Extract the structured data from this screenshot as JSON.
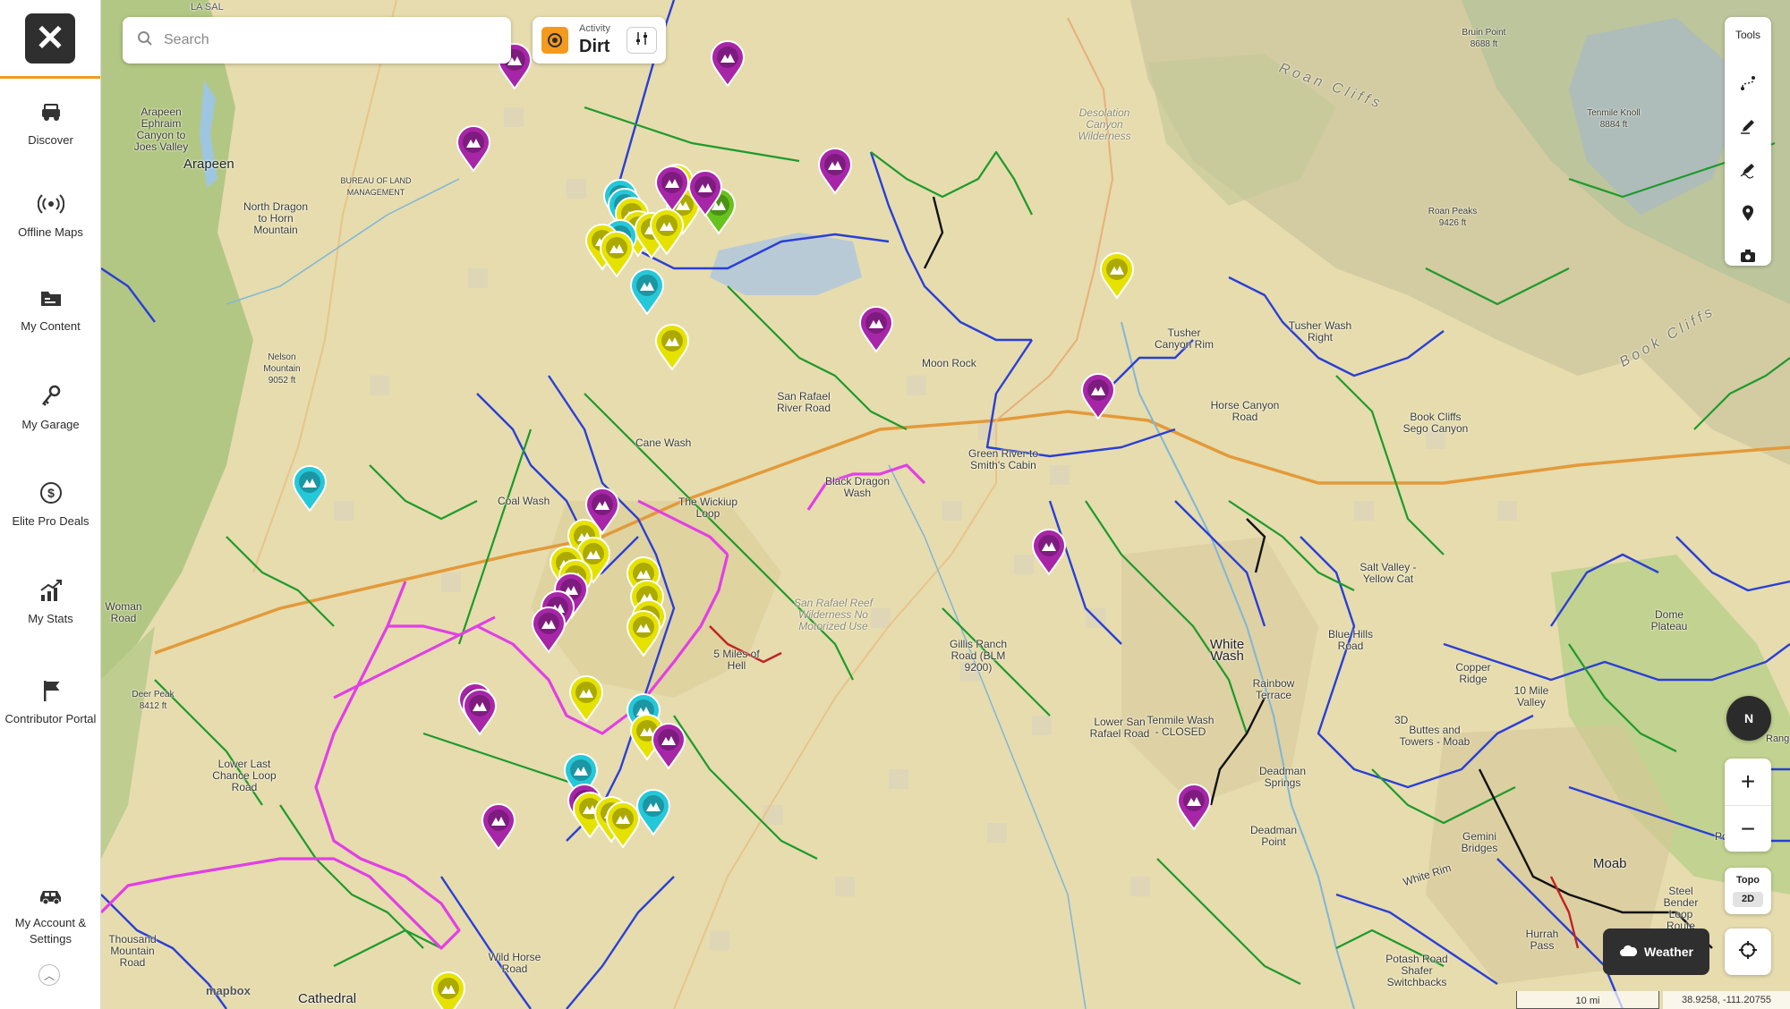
{
  "sidebar": {
    "close_label": "✕",
    "items": [
      {
        "label": "Discover",
        "icon": "jeep-icon"
      },
      {
        "label": "Offline Maps",
        "icon": "broadcast-icon"
      },
      {
        "label": "My Content",
        "icon": "folder-icon"
      },
      {
        "label": "My Garage",
        "icon": "keys-icon"
      },
      {
        "label": "Elite Pro Deals",
        "icon": "dollar-icon"
      },
      {
        "label": "My Stats",
        "icon": "stats-icon"
      },
      {
        "label": "Contributor Portal",
        "icon": "flag-icon"
      },
      {
        "label": "My Account & Settings",
        "icon": "vehicle-icon"
      }
    ],
    "collapse_icon": "chevron-up-icon"
  },
  "search": {
    "placeholder": "Search"
  },
  "activity": {
    "caption": "Activity",
    "value": "Dirt",
    "accent": "#f39a1f"
  },
  "tools": {
    "title": "Tools",
    "buttons": [
      "route-icon",
      "pencil-icon",
      "edit-pen-icon",
      "location-pin-icon",
      "camera-icon"
    ]
  },
  "compass": {
    "label": "N"
  },
  "zoom": {
    "in": "+",
    "out": "−"
  },
  "layer": {
    "name": "Topo",
    "mode": "2D"
  },
  "weather": {
    "label": "Weather"
  },
  "scale": {
    "label": "10 mi"
  },
  "coordinates": "38.9258, -111.20755",
  "attribution": "mapbox",
  "colors": {
    "trail_blue": "#2a3fd6",
    "trail_green": "#1d9a2c",
    "trail_magenta": "#e23fe6",
    "trail_black": "#111111",
    "trail_red": "#c22222",
    "pin_yellow": "#e6e200",
    "pin_magenta": "#a726a8",
    "pin_cyan": "#25c8d8",
    "pin_green": "#66c31d",
    "road_orange": "#e39a3a"
  },
  "map_labels": [
    "Arapeen",
    "Arapeen Ephraim Canyon to Joes Valley",
    "North Dragon to Horn Mountain",
    "BUREAU OF LAND MANAGEMENT",
    "Moon Rock",
    "San Rafael River Road",
    "Cane Wash",
    "Coal Wash",
    "The Wickiup Loop",
    "Black Dragon Wash",
    "Green River to Smith's Cabin",
    "Tusher Canyon Rim",
    "Tusher Wash Right",
    "Horse Canyon Road",
    "Book Cliffs Sego Canyon",
    "Salt Valley - Yellow Cat",
    "White Wash",
    "Blue Hills Road",
    "Copper Ridge",
    "10 Mile Valley",
    "Dome Plateau",
    "Gillis Ranch Road (BLM 9200)",
    "Lower San Rafael Road",
    "Tenmile Wash - CLOSED",
    "Rainbow Terrace",
    "Deadman Springs",
    "Deadman Point",
    "Buttes and Towers - Moab",
    "Gemini Bridges",
    "Porcupine Rim",
    "Moab",
    "White Rim",
    "Hurrah Pass",
    "Potash Road Shafer Switchbacks",
    "Steel Bender Loop Route",
    "5 Miles of Hell",
    "Lower Last Chance Loop Road",
    "Deer Peak 8412 ft",
    "Woman Road",
    "Thousand Mountain Road",
    "Wild Horse Road",
    "Cathedral",
    "Roan Cliffs",
    "Book Cliffs",
    "Desolation Canyon Wilderness",
    "San Rafael Reef Wilderness No Motorized Use",
    "Nelson Mountain 9052 ft",
    "Roan Peaks 9426 ft",
    "Tenmile Knoll 8884 ft",
    "Bruin Point 8688 ft",
    "LA SAL",
    "3D",
    "Range"
  ]
}
